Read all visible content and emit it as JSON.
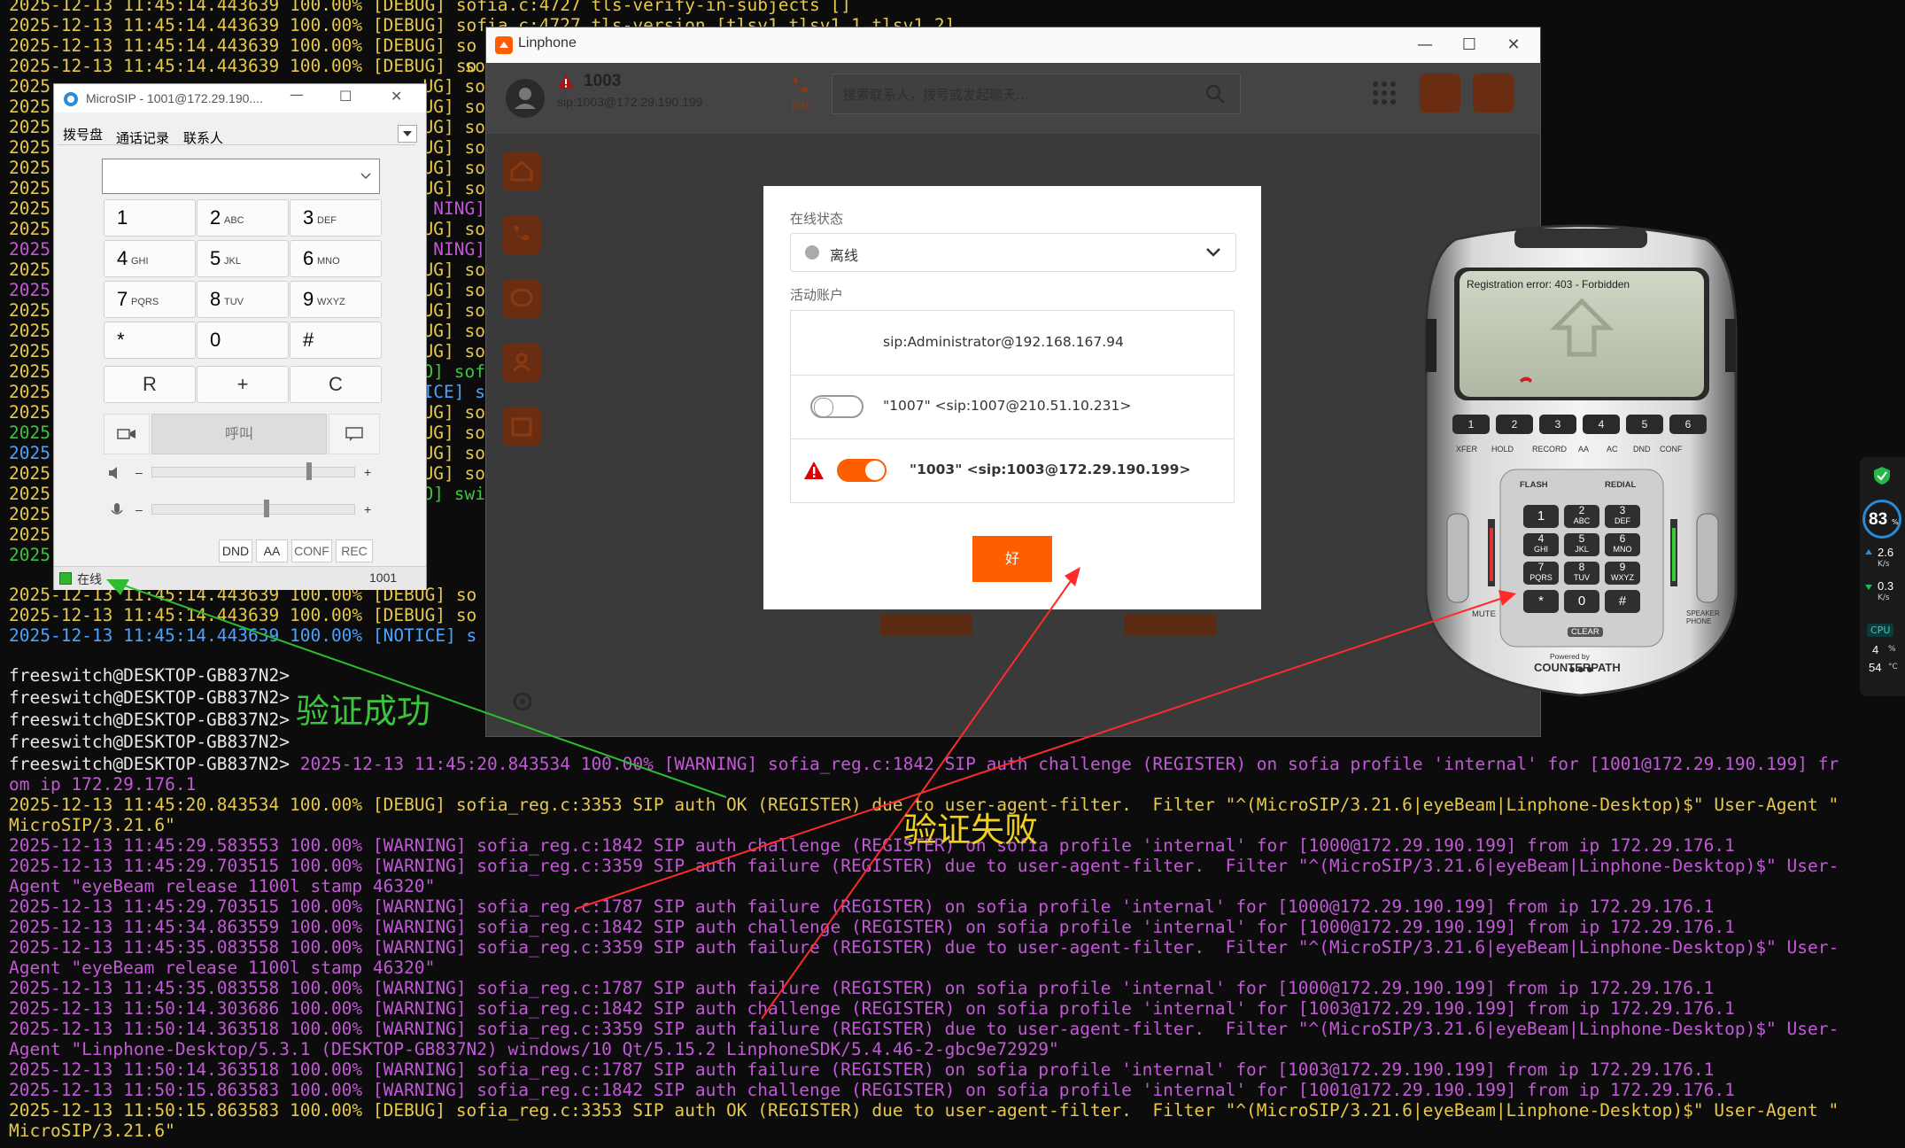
{
  "terminal": {
    "top_lines": [
      {
        "text": "2025-12-13 11:45:14.443639 100.00% [DEBUG] sofia.c:4727 tls-verify-in-subjects []",
        "cls": "c-debug"
      },
      {
        "text": "2025-12-13 11:45:14.443639 100.00% [DEBUG] sofia.c:4727 tls-version [tlsv1,tlsv1.1,tlsv1.2]",
        "cls": "c-debug"
      },
      {
        "text": "2025-12-13 11:45:14.443639 100.00% [DEBUG] so",
        "cls": "c-debug"
      },
      {
        "text": "2025-12-13 11:45:14.443639 100.00% [DEBUG] so",
        "cls": "c-debug"
      }
    ],
    "left_prefixes": [
      {
        "text": "2025",
        "cls": "c-debug"
      },
      {
        "text": "2025",
        "cls": "c-debug"
      },
      {
        "text": "2025",
        "cls": "c-debug"
      },
      {
        "text": "2025",
        "cls": "c-debug"
      },
      {
        "text": "2025",
        "cls": "c-debug"
      },
      {
        "text": "2025",
        "cls": "c-debug"
      },
      {
        "text": "2025",
        "cls": "c-debug"
      },
      {
        "text": "2025",
        "cls": "c-debug"
      },
      {
        "text": "2025",
        "cls": "c-warn"
      },
      {
        "text": "2025",
        "cls": "c-debug"
      },
      {
        "text": "2025",
        "cls": "c-warn"
      },
      {
        "text": "2025",
        "cls": "c-debug"
      },
      {
        "text": "2025",
        "cls": "c-debug"
      },
      {
        "text": "2025",
        "cls": "c-debug"
      },
      {
        "text": "2025",
        "cls": "c-debug"
      },
      {
        "text": "2025",
        "cls": "c-debug"
      },
      {
        "text": "2025",
        "cls": "c-debug"
      },
      {
        "text": "2025",
        "cls": "c-info"
      },
      {
        "text": "2025",
        "cls": "c-notice"
      },
      {
        "text": "2025",
        "cls": "c-debug"
      },
      {
        "text": "2025",
        "cls": "c-debug"
      },
      {
        "text": "2025",
        "cls": "c-debug"
      },
      {
        "text": "2025",
        "cls": "c-debug"
      },
      {
        "text": "2025",
        "cls": "c-info"
      }
    ],
    "mid_fragments": [
      {
        "text": "so",
        "cls": "c-debug"
      },
      {
        "text": "UG] so",
        "cls": "c-debug"
      },
      {
        "text": "UG] so",
        "cls": "c-debug"
      },
      {
        "text": "UG] so",
        "cls": "c-debug"
      },
      {
        "text": "UG] so",
        "cls": "c-debug"
      },
      {
        "text": "UG] so",
        "cls": "c-debug"
      },
      {
        "text": "UG] so",
        "cls": "c-debug"
      },
      {
        "text": "NING]",
        "cls": "c-warn"
      },
      {
        "text": "UG] so",
        "cls": "c-debug"
      },
      {
        "text": "NING]",
        "cls": "c-warn"
      },
      {
        "text": "UG] so",
        "cls": "c-debug"
      },
      {
        "text": "UG] so",
        "cls": "c-debug"
      },
      {
        "text": "UG] so",
        "cls": "c-debug"
      },
      {
        "text": "UG] so",
        "cls": "c-debug"
      },
      {
        "text": "UG] so",
        "cls": "c-debug"
      },
      {
        "text": "O] sof",
        "cls": "c-info"
      },
      {
        "text": "ICE] s",
        "cls": "c-notice"
      },
      {
        "text": "UG] so",
        "cls": "c-debug"
      },
      {
        "text": "UG] so",
        "cls": "c-debug"
      },
      {
        "text": "UG] so",
        "cls": "c-debug"
      },
      {
        "text": "UG] so",
        "cls": "c-debug"
      },
      {
        "text": "O] swi",
        "cls": "c-info"
      }
    ],
    "after_lines": [
      {
        "text": "2025-12-13 11:45:14.443639 100.00% [DEBUG] so",
        "cls": "c-debug"
      },
      {
        "text": "2025-12-13 11:45:14.443639 100.00% [DEBUG] so",
        "cls": "c-debug"
      },
      {
        "text": "2025-12-13 11:45:14.443639 100.00% [NOTICE] s",
        "cls": "c-notice"
      }
    ],
    "prompts": [
      "freeswitch@DESKTOP-GB837N2>",
      "freeswitch@DESKTOP-GB837N2>",
      "freeswitch@DESKTOP-GB837N2>",
      "freeswitch@DESKTOP-GB837N2>"
    ],
    "prompt_last": "freeswitch@DESKTOP-GB837N2>",
    "prompt_last_msg": " 2025-12-13 11:45:20.843534 100.00% [WARNING] sofia_reg.c:1842 SIP auth challenge (REGISTER) on sofia profile 'internal' for [1001@172.29.190.199] fr",
    "bottom_lines": [
      {
        "text": "om ip 172.29.176.1",
        "cls": "c-purple"
      },
      {
        "text": "2025-12-13 11:45:20.843534 100.00% [DEBUG] sofia_reg.c:3353 SIP auth OK (REGISTER) due to user-agent-filter.  Filter \"^(MicroSIP/3.21.6|eyeBeam|Linphone-Desktop)$\" User-Agent \"",
        "cls": "c-debug"
      },
      {
        "text": "MicroSIP/3.21.6\"",
        "cls": "c-debug"
      },
      {
        "text": "2025-12-13 11:45:29.583553 100.00% [WARNING] sofia_reg.c:1842 SIP auth challenge (REGISTER) on sofia profile 'internal' for [1000@172.29.190.199] from ip 172.29.176.1",
        "cls": "c-purple"
      },
      {
        "text": "2025-12-13 11:45:29.703515 100.00% [WARNING] sofia_reg.c:3359 SIP auth failure (REGISTER) due to user-agent-filter.  Filter \"^(MicroSIP/3.21.6|eyeBeam|Linphone-Desktop)$\" User-",
        "cls": "c-purple"
      },
      {
        "text": "Agent \"eyeBeam release 1100l stamp 46320\"",
        "cls": "c-purple"
      },
      {
        "text": "2025-12-13 11:45:29.703515 100.00% [WARNING] sofia_reg.c:1787 SIP auth failure (REGISTER) on sofia profile 'internal' for [1000@172.29.190.199] from ip 172.29.176.1",
        "cls": "c-purple"
      },
      {
        "text": "2025-12-13 11:45:34.863559 100.00% [WARNING] sofia_reg.c:1842 SIP auth challenge (REGISTER) on sofia profile 'internal' for [1000@172.29.190.199] from ip 172.29.176.1",
        "cls": "c-purple"
      },
      {
        "text": "2025-12-13 11:45:35.083558 100.00% [WARNING] sofia_reg.c:3359 SIP auth failure (REGISTER) due to user-agent-filter.  Filter \"^(MicroSIP/3.21.6|eyeBeam|Linphone-Desktop)$\" User-",
        "cls": "c-purple"
      },
      {
        "text": "Agent \"eyeBeam release 1100l stamp 46320\"",
        "cls": "c-purple"
      },
      {
        "text": "2025-12-13 11:45:35.083558 100.00% [WARNING] sofia_reg.c:1787 SIP auth failure (REGISTER) on sofia profile 'internal' for [1000@172.29.190.199] from ip 172.29.176.1",
        "cls": "c-purple"
      },
      {
        "text": "2025-12-13 11:50:14.303686 100.00% [WARNING] sofia_reg.c:1842 SIP auth challenge (REGISTER) on sofia profile 'internal' for [1003@172.29.190.199] from ip 172.29.176.1",
        "cls": "c-purple"
      },
      {
        "text": "2025-12-13 11:50:14.363518 100.00% [WARNING] sofia_reg.c:3359 SIP auth failure (REGISTER) due to user-agent-filter.  Filter \"^(MicroSIP/3.21.6|eyeBeam|Linphone-Desktop)$\" User-",
        "cls": "c-purple"
      },
      {
        "text": "Agent \"Linphone-Desktop/5.3.1 (DESKTOP-GB837N2) windows/10 Qt/5.15.2 LinphoneSDK/5.4.46-2-gbc9e72929\"",
        "cls": "c-purple"
      },
      {
        "text": "2025-12-13 11:50:14.363518 100.00% [WARNING] sofia_reg.c:1787 SIP auth failure (REGISTER) on sofia profile 'internal' for [1003@172.29.190.199] from ip 172.29.176.1",
        "cls": "c-purple"
      },
      {
        "text": "2025-12-13 11:50:15.863583 100.00% [WARNING] sofia_reg.c:1842 SIP auth challenge (REGISTER) on sofia profile 'internal' for [1001@172.29.190.199] from ip 172.29.176.1",
        "cls": "c-purple"
      },
      {
        "text": "2025-12-13 11:50:15.863583 100.00% [DEBUG] sofia_reg.c:3353 SIP auth OK (REGISTER) due to user-agent-filter.  Filter \"^(MicroSIP/3.21.6|eyeBeam|Linphone-Desktop)$\" User-Agent \"",
        "cls": "c-debug"
      },
      {
        "text": "MicroSIP/3.21.6\"",
        "cls": "c-debug"
      }
    ]
  },
  "linphone": {
    "title": "Linphone",
    "account_name": "1003",
    "account_uri": "sip:1003@172.29.190.199",
    "auto_label": "自动",
    "search_placeholder": "搜索联系人，拨号或发起聊天…",
    "dialog": {
      "status_label": "在线状态",
      "status_value": "离线",
      "accounts_label": "活动账户",
      "accounts": [
        {
          "text": "sip:Administrator@192.168.167.94"
        },
        {
          "text": "\"1007\" <sip:1007@210.51.10.231>"
        },
        {
          "text": "\"1003\" <sip:1003@172.29.190.199>"
        }
      ],
      "ok_label": "好"
    },
    "accent_color": "#fe5e00"
  },
  "microsip": {
    "title": "MicroSIP - 1001@172.29.190....",
    "tabs": [
      "拨号盘",
      "通话记录",
      "联系人"
    ],
    "keys": [
      {
        "main": "1",
        "sub": ""
      },
      {
        "main": "2",
        "sub": "ABC"
      },
      {
        "main": "3",
        "sub": "DEF"
      },
      {
        "main": "4",
        "sub": "GHI"
      },
      {
        "main": "5",
        "sub": "JKL"
      },
      {
        "main": "6",
        "sub": "MNO"
      },
      {
        "main": "7",
        "sub": "PQRS"
      },
      {
        "main": "8",
        "sub": "TUV"
      },
      {
        "main": "9",
        "sub": "WXYZ"
      },
      {
        "main": "*",
        "sub": ""
      },
      {
        "main": "0",
        "sub": ""
      },
      {
        "main": "#",
        "sub": ""
      }
    ],
    "extra_keys": [
      "R",
      "+",
      "C"
    ],
    "call_label": "呼叫",
    "bottom_buttons": [
      "DND",
      "AA",
      "CONF",
      "REC"
    ],
    "status": "在线",
    "account": "1001",
    "minus": "–",
    "plus": "+"
  },
  "eyebeam": {
    "status_text": "Registration error: 403 - Forbidden",
    "line_buttons": [
      "1",
      "2",
      "3",
      "4",
      "5",
      "6"
    ],
    "func_labels": [
      "XFER",
      "HOLD",
      "RECORD",
      "AA",
      "AC",
      "DND",
      "CONF"
    ],
    "flash": "FLASH",
    "redial": "REDIAL",
    "mute": "MUTE",
    "speaker": "SPEAKER PHONE",
    "clear": "CLEAR",
    "powered_by": "Powered by",
    "brand": "COUNTERPATH",
    "keypad": [
      {
        "main": "1",
        "sub": ""
      },
      {
        "main": "2",
        "sub": "ABC"
      },
      {
        "main": "3",
        "sub": "DEF"
      },
      {
        "main": "4",
        "sub": "GHI"
      },
      {
        "main": "5",
        "sub": "JKL"
      },
      {
        "main": "6",
        "sub": "MNO"
      },
      {
        "main": "7",
        "sub": "PQRS"
      },
      {
        "main": "8",
        "sub": "TUV"
      },
      {
        "main": "9",
        "sub": "WXYZ"
      },
      {
        "main": "*",
        "sub": ""
      },
      {
        "main": "0",
        "sub": ""
      },
      {
        "main": "#",
        "sub": ""
      }
    ]
  },
  "annotations": {
    "success": "验证成功",
    "failure": "验证失败"
  },
  "widget": {
    "percent": "83",
    "percent_unit": "%",
    "up_speed": "2.6",
    "up_unit": "K/s",
    "down_speed": "0.3",
    "down_unit": "K/s",
    "cpu_label": "CPU",
    "cpu_value": "4",
    "cpu_unit": "%",
    "temp_value": "54",
    "temp_unit": "°C"
  }
}
